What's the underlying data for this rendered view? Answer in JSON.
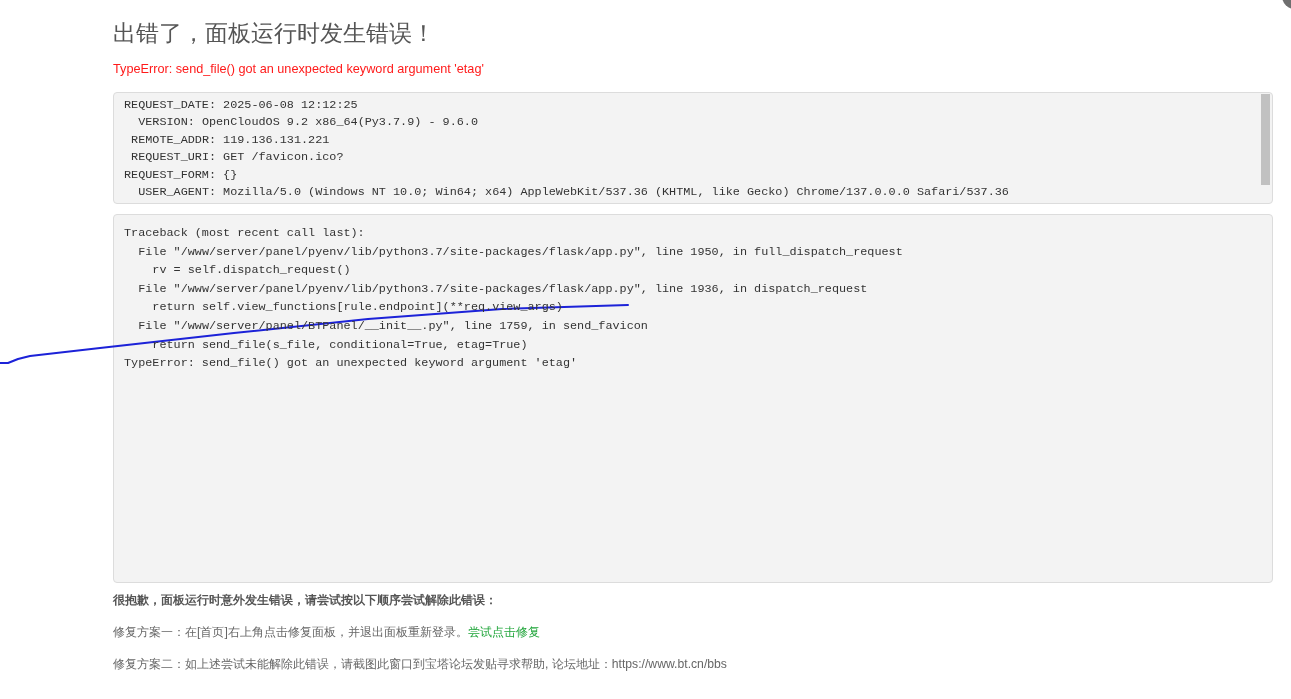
{
  "title": "出错了，面板运行时发生错误！",
  "error_message": "TypeError: send_file() got an unexpected keyword argument 'etag'",
  "request_info": [
    "REQUEST_DATE: 2025-06-08 12:12:25",
    "  VERSION: OpenCloudOS 9.2 x86_64(Py3.7.9) - 9.6.0",
    " REMOTE_ADDR: 119.136.131.221",
    " REQUEST_URI: GET /favicon.ico?",
    "REQUEST_FORM: {}",
    "  USER_AGENT: Mozilla/5.0 (Windows NT 10.0; Win64; x64) AppleWebKit/537.36 (KHTML, like Gecko) Chrome/137.0.0.0 Safari/537.36"
  ],
  "traceback": [
    "Traceback (most recent call last):",
    "  File \"/www/server/panel/pyenv/lib/python3.7/site-packages/flask/app.py\", line 1950, in full_dispatch_request",
    "    rv = self.dispatch_request()",
    "  File \"/www/server/panel/pyenv/lib/python3.7/site-packages/flask/app.py\", line 1936, in dispatch_request",
    "    return self.view_functions[rule.endpoint](**req.view_args)",
    "  File \"/www/server/panel/BTPanel/__init__.py\", line 1759, in send_favicon",
    "    return send_file(s_file, conditional=True, etag=True)",
    "TypeError: send_file() got an unexpected keyword argument 'etag'"
  ],
  "help": {
    "heading": "很抱歉，面板运行时意外发生错误，请尝试按以下顺序尝试解除此错误：",
    "solutions": [
      {
        "text": "修复方案一：在[首页]右上角点击修复面板，并退出面板重新登录。",
        "link": "尝试点击修复"
      },
      {
        "text": "修复方案二：如上述尝试未能解除此错误，请截图此窗口到宝塔论坛发贴寻求帮助, 论坛地址：https://www.bt.cn/bbs"
      }
    ]
  }
}
